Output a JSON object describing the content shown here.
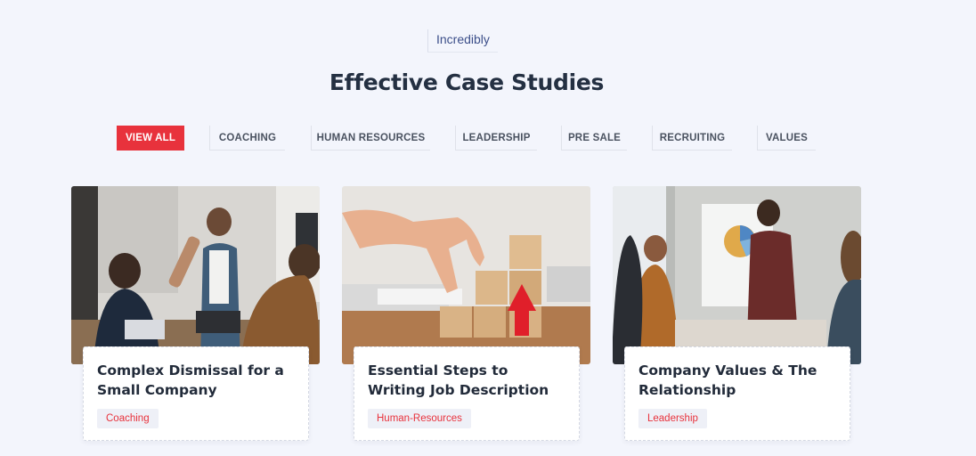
{
  "section": {
    "eyebrow": "Incredibly",
    "title": "Effective Case Studies"
  },
  "filters": [
    {
      "label": "VIEW ALL",
      "active": true
    },
    {
      "label": "COACHING",
      "active": false
    },
    {
      "label": "HUMAN RESOURCES",
      "active": false
    },
    {
      "label": "LEADERSHIP",
      "active": false
    },
    {
      "label": "PRE SALE",
      "active": false
    },
    {
      "label": "RECRUITING",
      "active": false
    },
    {
      "label": "VALUES",
      "active": false
    }
  ],
  "cards": [
    {
      "title": "Complex Dismissal for a Small Company",
      "tag": "Coaching"
    },
    {
      "title": "Essential Steps to Writing Job Description",
      "tag": "Human-Resources"
    },
    {
      "title": "Company Values & The Relationship",
      "tag": "Leadership"
    }
  ],
  "colors": {
    "accent": "#e8323c",
    "background": "#f3f5fc",
    "heading": "#243042",
    "eyebrow": "#3c4f8a"
  }
}
